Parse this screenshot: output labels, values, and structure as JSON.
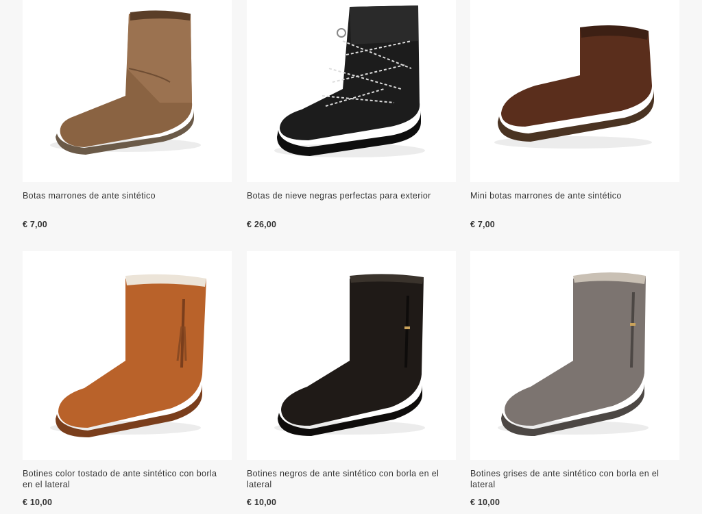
{
  "products": [
    {
      "name": "Botas marrones de ante sintético",
      "price": "€ 7,00",
      "image": "brown-suede-ankle-boot"
    },
    {
      "name": "Botas de nieve negras perfectas para exterior",
      "price": "€ 26,00",
      "image": "black-lace-up-snow-boot"
    },
    {
      "name": "Mini botas marrones de ante sintético",
      "price": "€ 7,00",
      "image": "brown-mini-boot"
    },
    {
      "name": "Botines color tostado de ante sintético con borla en el lateral",
      "price": "€ 10,00",
      "image": "tan-tassel-bootie"
    },
    {
      "name": "Botines negros de ante sintético con borla en el lateral",
      "price": "€ 10,00",
      "image": "black-tassel-bootie"
    },
    {
      "name": "Botines grises de ante sintético con borla en el lateral",
      "price": "€ 10,00",
      "image": "grey-tassel-bootie"
    }
  ],
  "colors": {
    "background": "#f7f7f7",
    "card": "#ffffff",
    "text": "#333333"
  }
}
